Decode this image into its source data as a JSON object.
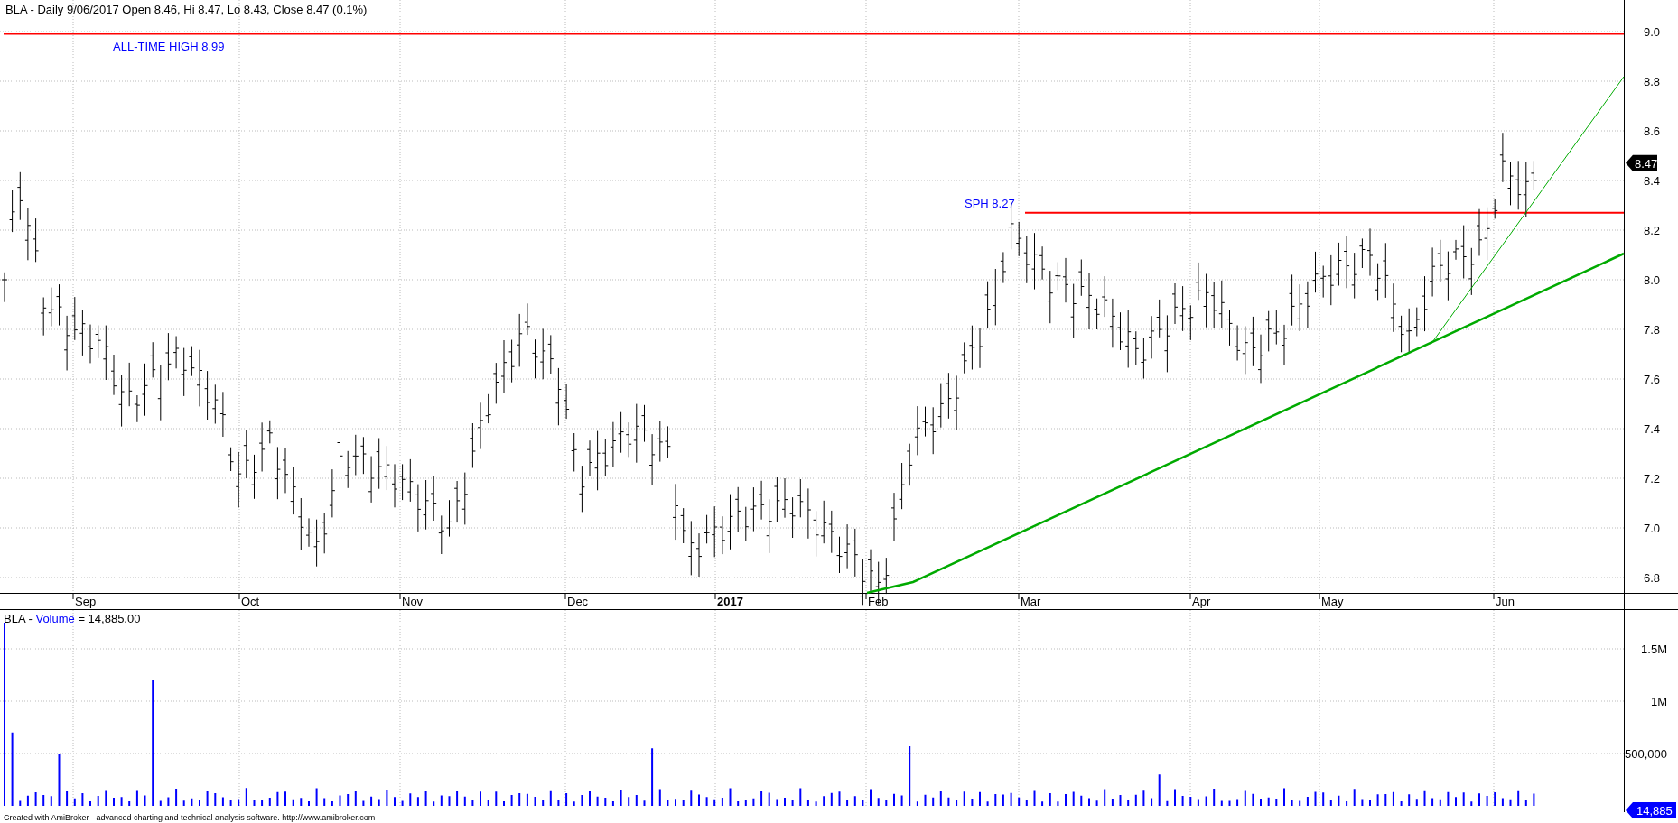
{
  "price_pane": {
    "title": "BLA - Daily 9/06/2017 Open 8.46, Hi 8.47, Lo 8.43, Close 8.47 (0.1%)",
    "annotations": [
      {
        "text": "ALL-TIME HIGH 8.99"
      },
      {
        "text": "SPH 8.27"
      }
    ],
    "y_axis": [
      "9.0",
      "8.8",
      "8.6",
      "8.4",
      "8.2",
      "8.0",
      "7.8",
      "7.6",
      "7.4",
      "7.2",
      "7.0",
      "6.8"
    ],
    "last_price": "8.47"
  },
  "x_axis": [
    {
      "text": "Sep",
      "bold": false
    },
    {
      "text": "Oct",
      "bold": false
    },
    {
      "text": "Nov",
      "bold": false
    },
    {
      "text": "Dec",
      "bold": false
    },
    {
      "text": "2017",
      "bold": true
    },
    {
      "text": "Feb",
      "bold": false
    },
    {
      "text": "Mar",
      "bold": false
    },
    {
      "text": "Apr",
      "bold": false
    },
    {
      "text": "May",
      "bold": false
    },
    {
      "text": "Jun",
      "bold": false
    }
  ],
  "volume_pane": {
    "symbol": "BLA - ",
    "indicator": "Volume",
    "reading": " = 14,885.00",
    "y_axis": [
      "1.5M",
      "1M",
      "500,000"
    ],
    "last_volume": "14,885"
  },
  "footer": "Created with AmiBroker - advanced charting and technical analysis software. http://www.amibroker.com"
}
